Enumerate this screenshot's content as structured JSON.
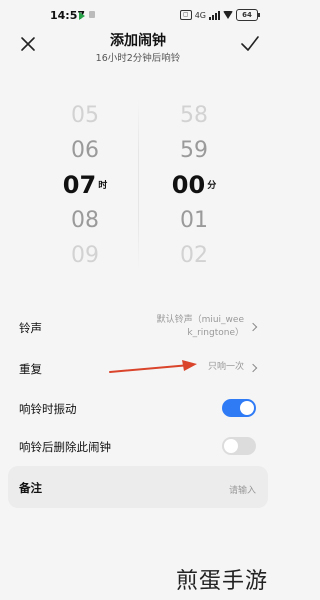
{
  "status_bar": {
    "time": "14:57",
    "sim_label": "4G",
    "battery": "64"
  },
  "header": {
    "title": "添加闹钟",
    "subtitle": "16小时2分钟后响铃",
    "close_icon": "close-icon",
    "confirm_icon": "check-icon"
  },
  "time_picker": {
    "hours": [
      "05",
      "06",
      "07",
      "08",
      "09"
    ],
    "minutes": [
      "58",
      "59",
      "00",
      "01",
      "02"
    ],
    "selected_hour": "07",
    "selected_minute": "00",
    "hour_unit": "时",
    "minute_unit": "分"
  },
  "settings": {
    "ringtone": {
      "label": "铃声",
      "value_line1": "默认铃声（miui_wee",
      "value_line2": "k_ringtone）"
    },
    "repeat": {
      "label": "重复",
      "value": "只响一次"
    },
    "vibrate": {
      "label": "响铃时振动",
      "enabled": true
    },
    "delete_after": {
      "label": "响铃后删除此闹钟",
      "enabled": false
    },
    "notes": {
      "label": "备注",
      "placeholder": "请输入"
    }
  },
  "colors": {
    "toggle_on": "#2f7bf6",
    "toggle_off": "#dcdcdc",
    "annotation_arrow": "#d9442b"
  },
  "watermark": "煎蛋手游"
}
